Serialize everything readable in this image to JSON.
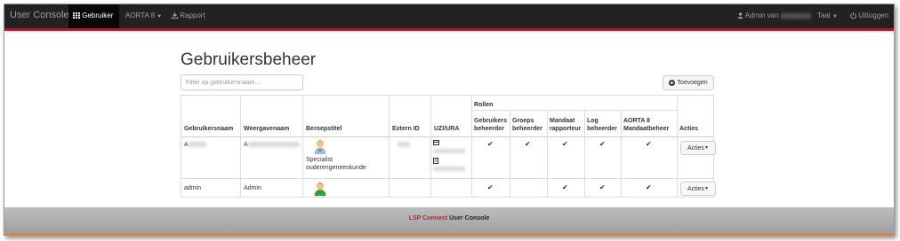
{
  "navbar": {
    "brand": "User Console",
    "items": [
      {
        "label": "Gebruiker",
        "icon": "grid-icon",
        "active": true
      },
      {
        "label": "AORTA 8",
        "icon": "caret-down-icon",
        "active": false
      },
      {
        "label": "Rapport",
        "icon": "download-icon",
        "active": false
      }
    ],
    "right": {
      "admin_label": "Admin van",
      "language_label": "Taal",
      "logout_label": "Uitloggen"
    }
  },
  "main": {
    "title": "Gebruikersbeheer",
    "filter_placeholder": "Filter op gebruikersnaam...",
    "add_button_label": "Toevoegen",
    "table": {
      "headers": {
        "username": "Gebruikersnaam",
        "display_name": "Weergavenaam",
        "profession": "Beroepstitel",
        "extern_id": "Extern ID",
        "uzi_ura": "UZI/URA",
        "roles_group": "Rollen",
        "roles": [
          [
            "Gebruikers",
            "beheerder"
          ],
          [
            "Groeps",
            "beheerder"
          ],
          [
            "Mandaat",
            "rapporteur"
          ],
          [
            "Log",
            "beheerder"
          ],
          [
            "AORTA 8",
            "Mandaatbeheer"
          ]
        ],
        "actions": "Acties"
      },
      "rows": [
        {
          "username": "A",
          "display_name": "A",
          "profession_lines": [
            "Specialist",
            "ouderengeneeskunde"
          ],
          "roles": [
            true,
            true,
            true,
            true,
            true
          ],
          "actions_label": "Acties"
        },
        {
          "username": "admin",
          "display_name": "Admin",
          "profession_lines": [],
          "roles": [
            true,
            false,
            true,
            true,
            true
          ],
          "actions_label": "Acties"
        }
      ]
    }
  },
  "footer": {
    "brand_part1": "LSP Connect",
    "brand_part2": "User Console"
  },
  "colors": {
    "navbar_bg": "#222222",
    "accent_red": "#b51f2d",
    "footer_orange": "#e87722"
  }
}
